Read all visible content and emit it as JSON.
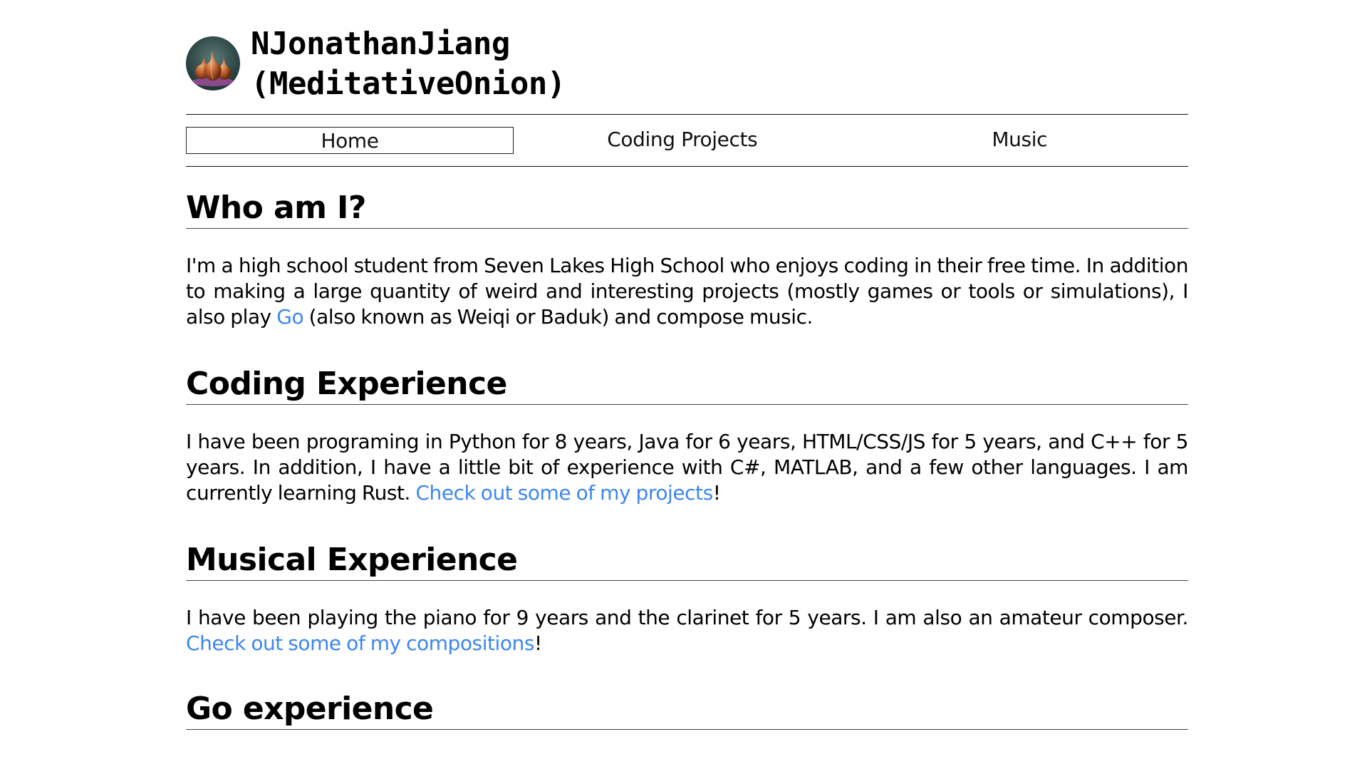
{
  "header": {
    "avatar_icon": "onion-avatar-icon",
    "title": "NJonathanJiang\n(MeditativeOnion)"
  },
  "nav": {
    "items": [
      {
        "label": "Home",
        "active": true
      },
      {
        "label": "Coding Projects",
        "active": false
      },
      {
        "label": "Music",
        "active": false
      }
    ]
  },
  "sections": {
    "who": {
      "heading": "Who am I?",
      "text_before_link": "I'm a high school student from Seven Lakes High School who enjoys coding in their free time. In addition to making a large quantity of weird and interesting projects (mostly games or tools or simulations), I also play ",
      "link": "Go",
      "text_after_link": " (also known as Weiqi or Baduk) and compose music."
    },
    "coding": {
      "heading": "Coding Experience",
      "text_before_link": "I have been programing in Python for 8 years, Java for 6 years, HTML/CSS/JS for 5 years, and C++ for 5 years. In addition, I have a little bit of experience with C#, MATLAB, and a few other languages. I am currently learning Rust. ",
      "link": "Check out some of my projects",
      "text_after_link": "!"
    },
    "music": {
      "heading": "Musical Experience",
      "text_before_link": "I have been playing the piano for 9 years and the clarinet for 5 years. I am also an amateur composer. ",
      "link": "Check out some of my compositions",
      "text_after_link": "!"
    },
    "go": {
      "heading": "Go experience"
    }
  },
  "colors": {
    "link": "#3d86f0",
    "text": "#000000",
    "background": "#ffffff"
  }
}
